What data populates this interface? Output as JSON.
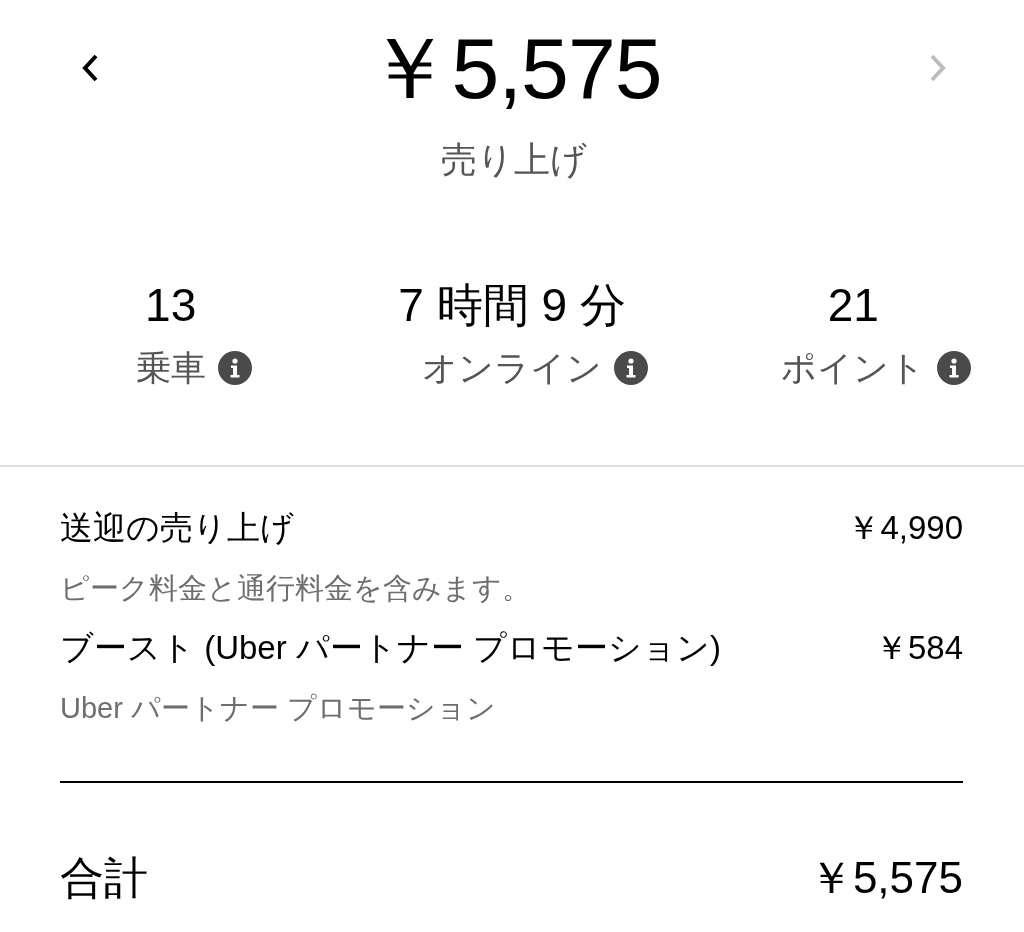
{
  "header": {
    "prev_button": {
      "disabled": false
    },
    "next_button": {
      "disabled": true
    },
    "amount": "￥5,575",
    "label": "売り上げ"
  },
  "stats": [
    {
      "value": "13",
      "label": "乗車"
    },
    {
      "value": "7 時間 9 分",
      "label": "オンライン"
    },
    {
      "value": "21",
      "label": "ポイント"
    }
  ],
  "breakdown": [
    {
      "title": "送迎の売り上げ",
      "amount": "￥4,990",
      "note": "ピーク料金と通行料金を含みます。"
    },
    {
      "title": "ブースト (Uber パートナー プロモーション)",
      "amount": "￥584",
      "note": "Uber パートナー プロモーション"
    }
  ],
  "total": {
    "label": "合計",
    "amount": "￥5,575"
  }
}
